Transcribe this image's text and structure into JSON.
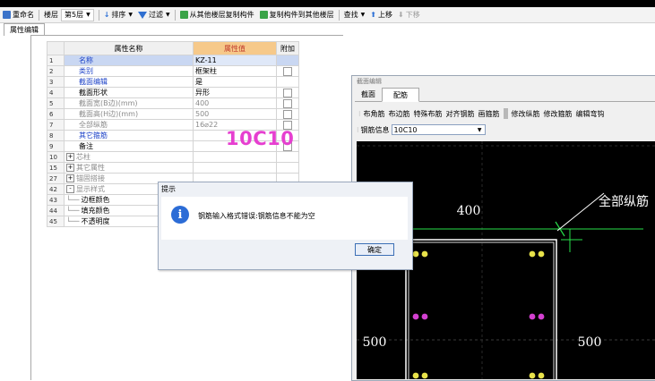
{
  "toolbar": {
    "rename": "重命名",
    "floor_label": "楼层",
    "floor_value": "第5层",
    "sort": "排序",
    "filter": "过滤",
    "copy_from": "从其他楼层复制构件",
    "copy_to": "复制构件到其他楼层",
    "find": "查找",
    "move_up": "上移",
    "move_down": "下移"
  },
  "property_panel": {
    "tab": "属性编辑",
    "headers": {
      "name": "属性名称",
      "value": "属性值",
      "extra": "附加"
    },
    "rows": [
      {
        "num": "1",
        "name": "名称",
        "value": "KZ-11",
        "style": "blue"
      },
      {
        "num": "2",
        "name": "类别",
        "value": "框架柱",
        "style": "blue"
      },
      {
        "num": "3",
        "name": "截面编辑",
        "value": "是",
        "style": "blue"
      },
      {
        "num": "4",
        "name": "截面形状",
        "value": "异形",
        "style": "normal"
      },
      {
        "num": "5",
        "name": "截面宽(B边)(mm)",
        "value": "400",
        "style": "gray"
      },
      {
        "num": "6",
        "name": "截面高(H边)(mm)",
        "value": "500",
        "style": "gray"
      },
      {
        "num": "7",
        "name": "全部纵筋",
        "value": "16⌀22",
        "style": "gray"
      },
      {
        "num": "8",
        "name": "其它箍筋",
        "value": "",
        "style": "blue"
      },
      {
        "num": "9",
        "name": "备注",
        "value": "",
        "style": "normal"
      },
      {
        "num": "10",
        "name": "芯柱",
        "value": "",
        "style": "gray",
        "expander": "+"
      },
      {
        "num": "15",
        "name": "其它属性",
        "value": "",
        "style": "gray",
        "expander": "+"
      },
      {
        "num": "27",
        "name": "锚固搭接",
        "value": "",
        "style": "gray",
        "expander": "+"
      },
      {
        "num": "42",
        "name": "显示样式",
        "value": "",
        "style": "gray",
        "expander": "-"
      },
      {
        "num": "43",
        "name": "边框颜色",
        "value": "",
        "style": "child"
      },
      {
        "num": "44",
        "name": "填充颜色",
        "value": "",
        "style": "child"
      },
      {
        "num": "45",
        "name": "不透明度",
        "value": "",
        "style": "child"
      }
    ]
  },
  "overlay_text": "10C10",
  "editor": {
    "title": "截面编辑",
    "tabs": [
      "截面",
      "配筋"
    ],
    "tools": [
      "布角筋",
      "布边筋",
      "特殊布筋",
      "对齐钢筋",
      "画箍筋",
      "修改纵筋",
      "修改箍筋",
      "编辑弯钩"
    ],
    "rebar_label": "钢筋信息",
    "rebar_value": "10C10",
    "canvas": {
      "dim_width": "400",
      "dim_height_left": "500",
      "dim_height_right": "500",
      "annotation": "全部纵筋"
    }
  },
  "dialog": {
    "title": "提示",
    "message": "钢筋输入格式错误:钢筋信息不能为空",
    "ok": "确定"
  },
  "colors": {
    "overlay": "#e63fd0",
    "rebar_yellow": "#e8e24a",
    "rebar_magenta": "#d340d0",
    "dim_green": "#28e04a"
  }
}
